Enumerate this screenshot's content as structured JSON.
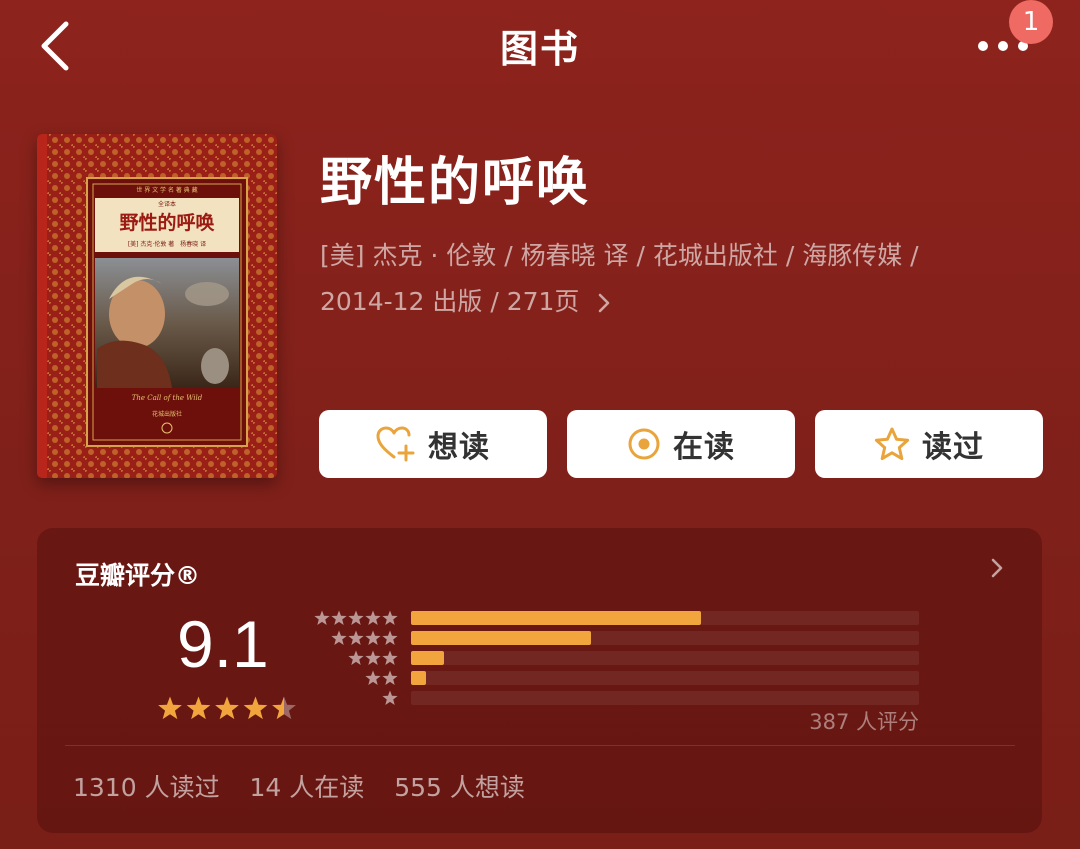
{
  "header": {
    "title": "图书",
    "notification_count": "1"
  },
  "book": {
    "title": "野性的呼唤",
    "meta_line1": "[美] 杰克 · 伦敦 / 杨春晓 译 / 花城出版社 / 海豚传媒 /",
    "meta_line2": "2014-12 出版 / 271页",
    "cover": {
      "series": "世 界 文 学 名 著 典 藏",
      "label": "全译本",
      "title": "野性的呼唤",
      "byline": "[美] 杰克·伦敦 著　杨春晓 译",
      "english_title": "The Call of the Wild",
      "publisher": "花城出版社"
    }
  },
  "actions": [
    {
      "label": "想读",
      "icon": "heart-plus-icon"
    },
    {
      "label": "在读",
      "icon": "target-icon"
    },
    {
      "label": "读过",
      "icon": "star-outline-icon"
    }
  ],
  "rating": {
    "title": "豆瓣评分®",
    "score": "9.1",
    "star_level": 4.5,
    "count_text": "387 人评分",
    "distribution": [
      {
        "stars": 5,
        "fraction": 0.57
      },
      {
        "stars": 4,
        "fraction": 0.355
      },
      {
        "stars": 3,
        "fraction": 0.065
      },
      {
        "stars": 2,
        "fraction": 0.03
      },
      {
        "stars": 1,
        "fraction": 0.0
      }
    ],
    "stats": [
      "1310 人读过",
      "14 人在读",
      "555 人想读"
    ]
  },
  "colors": {
    "accent": "#f3a53d",
    "background": "#8d231c",
    "badge": "#ef6a62"
  }
}
